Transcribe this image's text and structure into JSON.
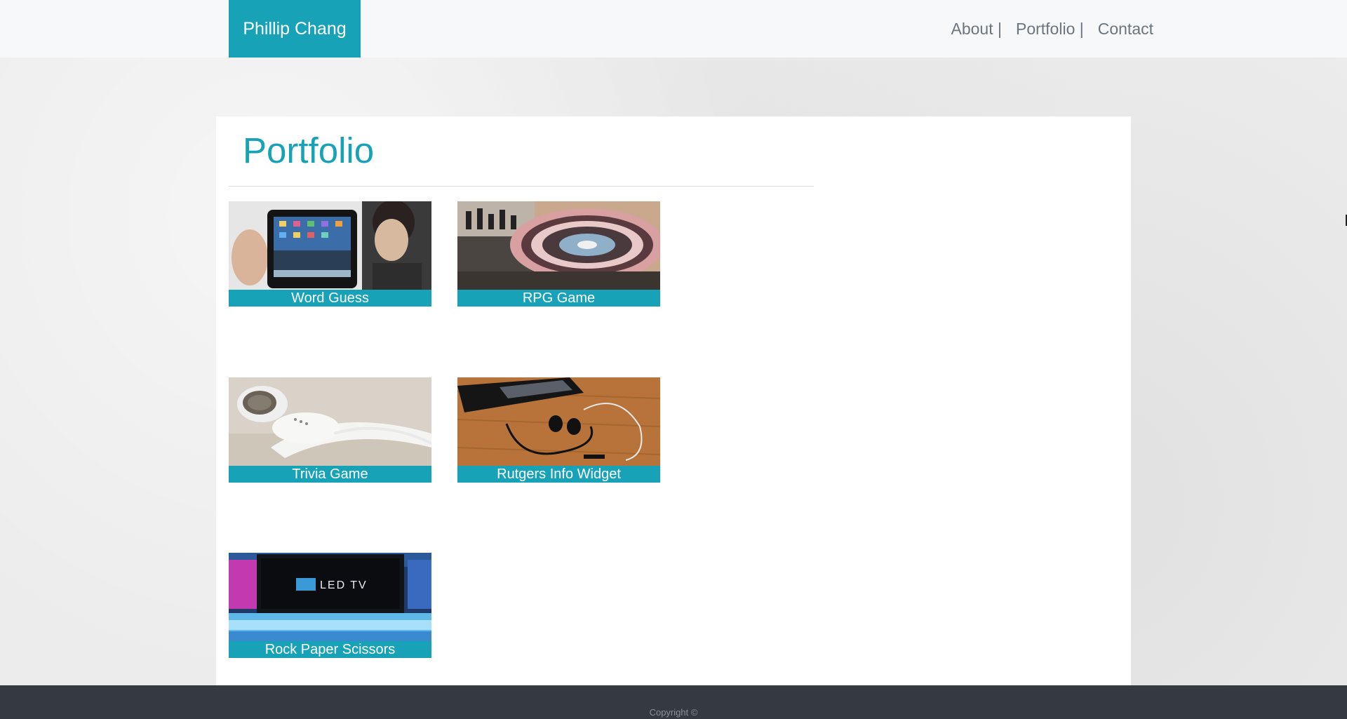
{
  "header": {
    "brand": "Phillip Chang",
    "nav": [
      {
        "label": "About |"
      },
      {
        "label": "Portfolio |"
      },
      {
        "label": "Contact"
      }
    ]
  },
  "main": {
    "title": "Portfolio",
    "projects": [
      {
        "title": "Word Guess",
        "thumbnail_icon": "tablet-photo"
      },
      {
        "title": "RPG Game",
        "thumbnail_icon": "turntable-photo"
      },
      {
        "title": "Trivia Game",
        "thumbnail_icon": "earbuds-photo"
      },
      {
        "title": "Rutgers Info Widget",
        "thumbnail_icon": "smartphone-earphones-photo"
      },
      {
        "title": "Rock Paper Scissors",
        "thumbnail_icon": "led-tv-photo"
      }
    ],
    "tv_logo_text": "LED TV"
  },
  "footer": {
    "copyright": "Copyright ©"
  },
  "colors": {
    "accent": "#17a2b8",
    "navbar_bg": "#f7f8f9",
    "footer_bg": "#343a40",
    "nav_text": "#6c757d"
  }
}
